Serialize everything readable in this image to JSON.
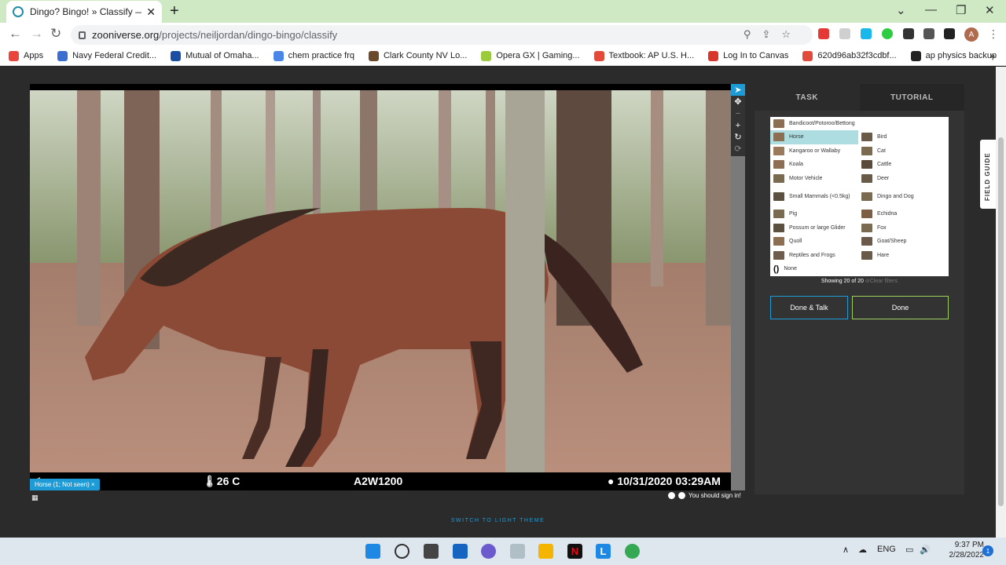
{
  "browser": {
    "tab_title": "Dingo? Bingo! » Classify — Zoon",
    "url_host": "zooniverse.org",
    "url_path": "/projects/neiljordan/dingo-bingo/classify",
    "avatar_letter": "A",
    "bookmarks": [
      {
        "label": "Apps",
        "color": "#e8453c"
      },
      {
        "label": "Navy Federal Credit...",
        "color": "#3a6fd1"
      },
      {
        "label": "Mutual of Omaha...",
        "color": "#1a4fa3"
      },
      {
        "label": "chem practice frq",
        "color": "#4a86e8"
      },
      {
        "label": "Clark County NV Lo...",
        "color": "#6a4a2a"
      },
      {
        "label": "Opera GX | Gaming...",
        "color": "#9bcb3c"
      },
      {
        "label": "Textbook: AP U.S. H...",
        "color": "#e34a3a"
      },
      {
        "label": "Log In to Canvas",
        "color": "#d9352a"
      },
      {
        "label": "620d96ab32f3cdbf...",
        "color": "#e04b3a"
      },
      {
        "label": "ap physics backup",
        "color": "#222222"
      }
    ]
  },
  "subject": {
    "temperature": "26 C",
    "camera_id": "A2W1200",
    "timestamp": "10/31/2020  03:29AM",
    "marker_label": "Horse (1; Not seen)",
    "sign_in_note": "You should sign in!"
  },
  "task_panel": {
    "tab_task": "TASK",
    "tab_tutorial": "TUTORIAL",
    "choices_top": "Bandicoot/Potoroo/Bettong",
    "choices_left": [
      "Horse",
      "Kangaroo or Wallaby",
      "Koala",
      "Motor Vehicle",
      "Small Mammals (<0.5kg)",
      "Pig",
      "Possum or large Glider",
      "Quoll",
      "Reptiles and Frogs"
    ],
    "choices_right": [
      "Bird",
      "Cat",
      "Cattle",
      "Deer",
      "Dingo and Dog",
      "Echidna",
      "Fox",
      "Goat/Sheep",
      "Hare"
    ],
    "choice_none": "None",
    "selected": "Horse",
    "showing": "Showing 20 of 20",
    "clear_filters": "Clear filters",
    "done_talk": "Done & Talk",
    "done": "Done",
    "field_guide": "FIELD GUIDE",
    "theme_switch": "SWITCH TO LIGHT THEME"
  },
  "taskbar": {
    "lang": "ENG",
    "time": "9:37 PM",
    "date": "2/28/2022",
    "notifications": "1"
  }
}
